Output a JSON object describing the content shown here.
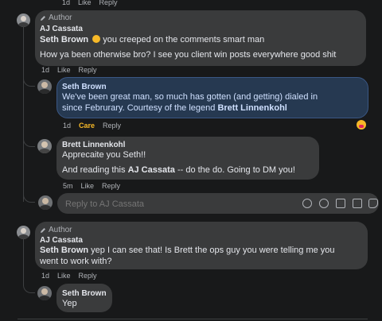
{
  "top_actions": {
    "time": "1d",
    "like": "Like",
    "reply": "Reply"
  },
  "comments": [
    {
      "author_tag": "Author",
      "name": "AJ Cassata",
      "mention": "Seth Brown",
      "line1_rest": " you creeped on the comments smart man",
      "line2": "How ya been otherwise bro? I see you client win posts everywhere good shit",
      "actions": {
        "time": "1d",
        "like": "Like",
        "reply": "Reply"
      }
    },
    {
      "name": "Seth Brown",
      "line1": "We've been great man, so much has gotten (and getting) dialed in",
      "line2_prefix": "since Februrary. Courtesy of the legend ",
      "line2_mention": "Brett Linnenkohl",
      "actions": {
        "time": "1d",
        "reaction": "Care",
        "reply": "Reply"
      }
    },
    {
      "name": "Brett Linnenkohl",
      "line1": "Apprecaite you Seth!!",
      "line2_prefix": "And reading this ",
      "line2_mention": "AJ Cassata",
      "line2_rest": " -- do the do. Going to DM you!",
      "actions": {
        "time": "5m",
        "like": "Like",
        "reply": "Reply"
      }
    },
    {
      "author_tag": "Author",
      "name": "AJ Cassata",
      "mention": "Seth Brown",
      "line1_rest": " yep I can see that! Is Brett the ops guy you were telling me you",
      "line2": "went to work with?",
      "actions": {
        "time": "1d",
        "like": "Like",
        "reply": "Reply"
      }
    },
    {
      "name": "Seth Brown",
      "line1": "Yep"
    }
  ],
  "reply_box": {
    "placeholder": "Reply to AJ Cassata"
  },
  "icons": [
    "pencil-icon",
    "smile-emoji-icon",
    "care-reaction-icon",
    "sticker-icon",
    "emoji-icon",
    "camera-icon",
    "gif-icon",
    "sticker-picker-icon"
  ]
}
